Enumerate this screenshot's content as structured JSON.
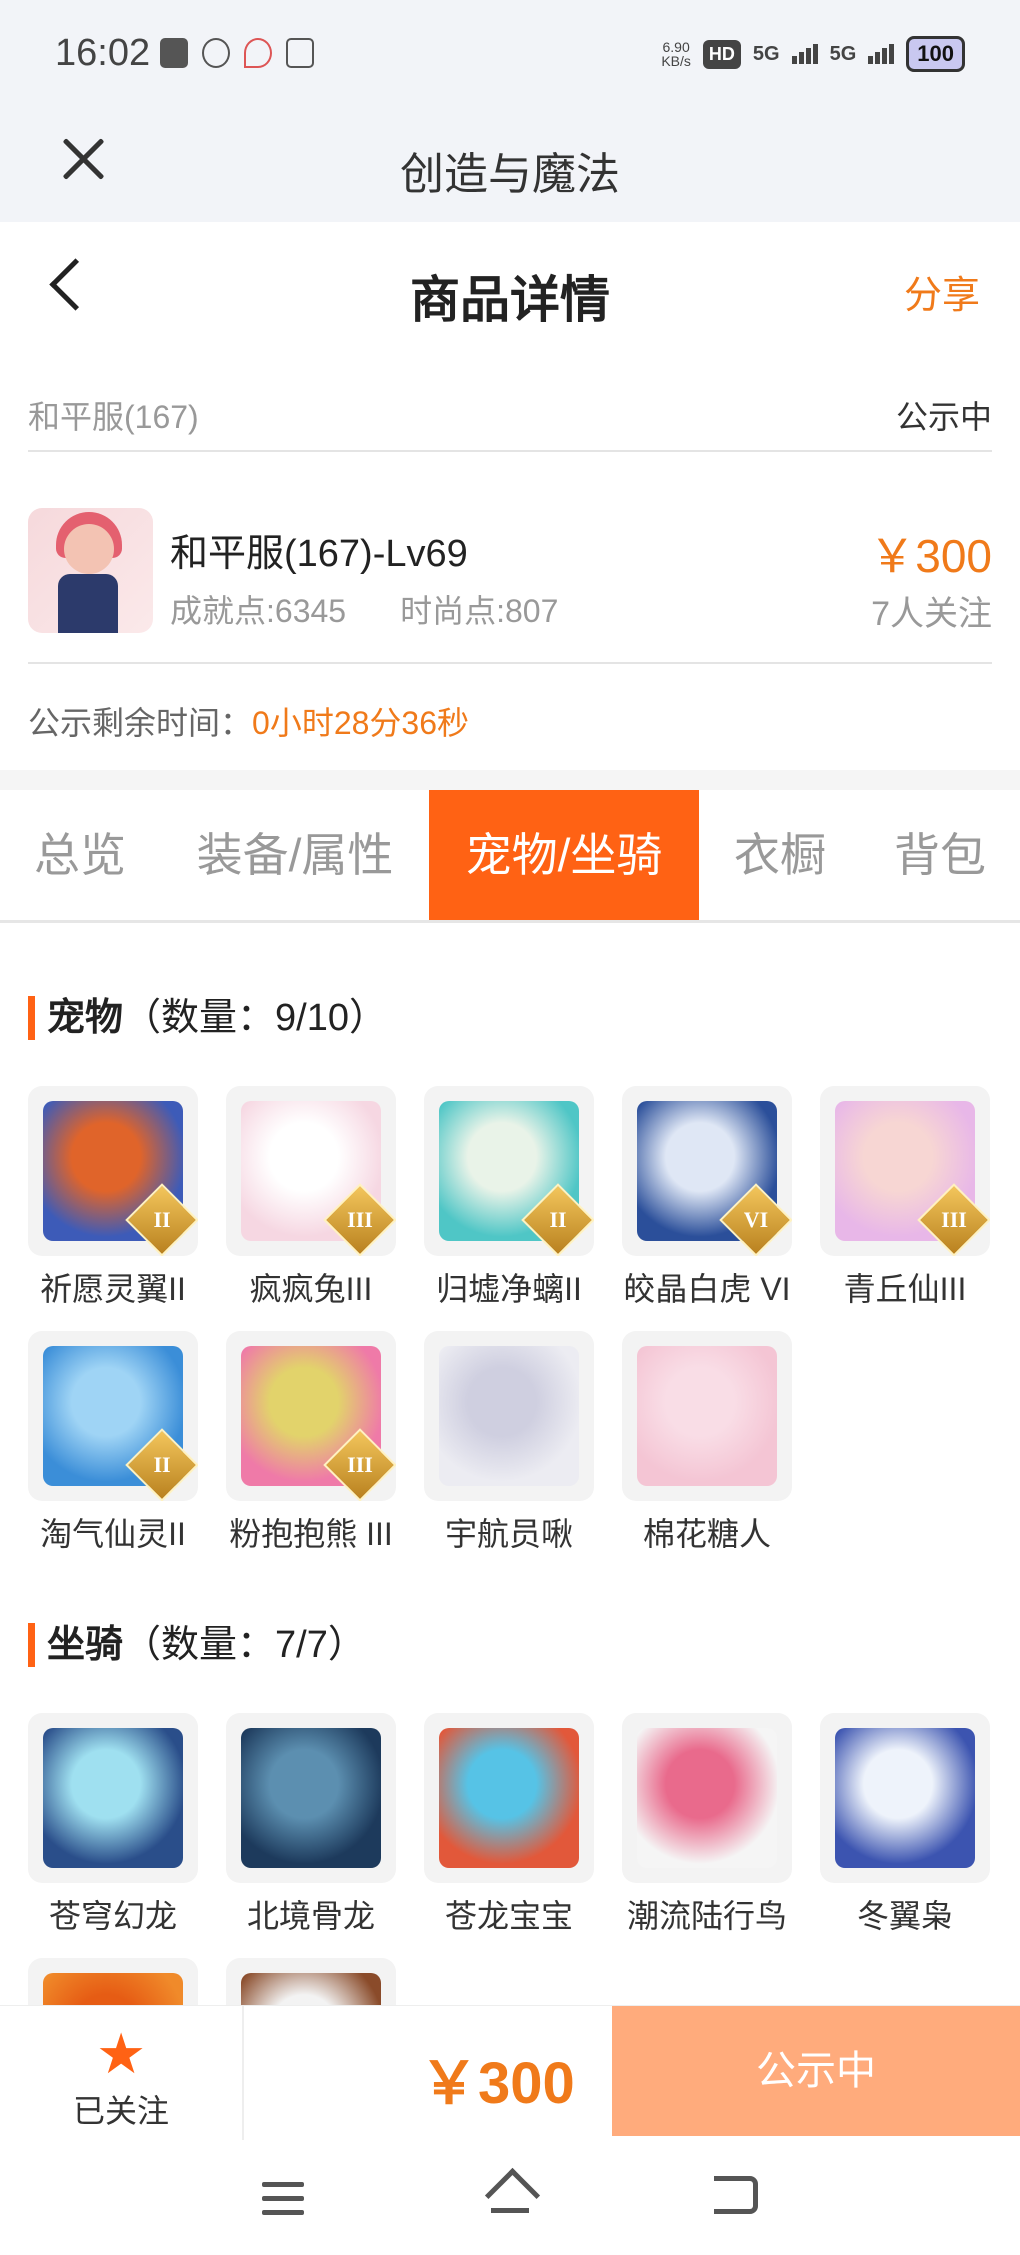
{
  "status_bar": {
    "time": "16:02",
    "net_speed": "6.90",
    "net_unit": "KB/s",
    "hd": "HD",
    "sig1": "5G",
    "sig2": "5G",
    "battery": "100"
  },
  "app_bar": {
    "title": "创造与魔法"
  },
  "header": {
    "title": "商品详情",
    "share": "分享"
  },
  "listing": {
    "server": "和平服(167)",
    "status": "公示中",
    "name": "和平服(167)-Lv69",
    "achievement": "成就点:6345",
    "fashion": "时尚点:807",
    "price": "￥300",
    "followers": "7人关注",
    "remaining_label": "公示剩余时间：",
    "remaining_time": "0小时28分36秒"
  },
  "tabs": [
    {
      "label": "总览"
    },
    {
      "label": "装备/属性"
    },
    {
      "label": "宠物/坐骑",
      "active": true
    },
    {
      "label": "衣橱"
    },
    {
      "label": "背包"
    }
  ],
  "pets": {
    "title": "宠物",
    "count": "（数量：9/10）",
    "items": [
      {
        "name": "祈愿灵翼II",
        "tier": "II",
        "colors": [
          "#3d5bb8",
          "#e0642a"
        ]
      },
      {
        "name": "疯疯兔III",
        "tier": "III",
        "colors": [
          "#f6d7e2",
          "#ffffff"
        ]
      },
      {
        "name": "归墟净螭II",
        "tier": "II",
        "colors": [
          "#4fc6c6",
          "#e9f3e8"
        ]
      },
      {
        "name": "皎晶白虎 VI",
        "tier": "VI",
        "colors": [
          "#2b4f9a",
          "#dfe7f5"
        ]
      },
      {
        "name": "青丘仙III",
        "tier": "III",
        "colors": [
          "#e8b7e8",
          "#f7d6d3"
        ]
      },
      {
        "name": "淘气仙灵II",
        "tier": "II",
        "colors": [
          "#3b8ed8",
          "#9fd4f5"
        ]
      },
      {
        "name": "粉抱抱熊 III",
        "tier": "III",
        "colors": [
          "#ef7aa8",
          "#e2d36b"
        ]
      },
      {
        "name": "宇航员啾",
        "tier": "",
        "colors": [
          "#ececf2",
          "#cfcfe0"
        ]
      },
      {
        "name": "棉花糖人",
        "tier": "",
        "colors": [
          "#f4c5d4",
          "#f9dde6"
        ]
      }
    ]
  },
  "mounts": {
    "title": "坐骑",
    "count": "（数量：7/7）",
    "items": [
      {
        "name": "苍穹幻龙",
        "colors": [
          "#2a4e8a",
          "#9fe0f0"
        ]
      },
      {
        "name": "北境骨龙",
        "colors": [
          "#1d3a5c",
          "#5c8fb0"
        ]
      },
      {
        "name": "苍龙宝宝",
        "colors": [
          "#e2583a",
          "#56c3e6"
        ]
      },
      {
        "name": "潮流陆行鸟",
        "colors": [
          "#f5f5f5",
          "#e96a8c"
        ]
      },
      {
        "name": "冬翼枭",
        "colors": [
          "#3c54b0",
          "#eef3fb"
        ]
      },
      {
        "name": "",
        "colors": [
          "#f08a2a",
          "#e65c14"
        ]
      },
      {
        "name": "",
        "colors": [
          "#8a4b2a",
          "#f3f3f3"
        ]
      }
    ]
  },
  "bottom_bar": {
    "follow_label": "已关注",
    "price": "￥300",
    "status_button": "公示中"
  },
  "theme": {
    "accent": "#ff6214",
    "price_color": "#f07a1a"
  }
}
